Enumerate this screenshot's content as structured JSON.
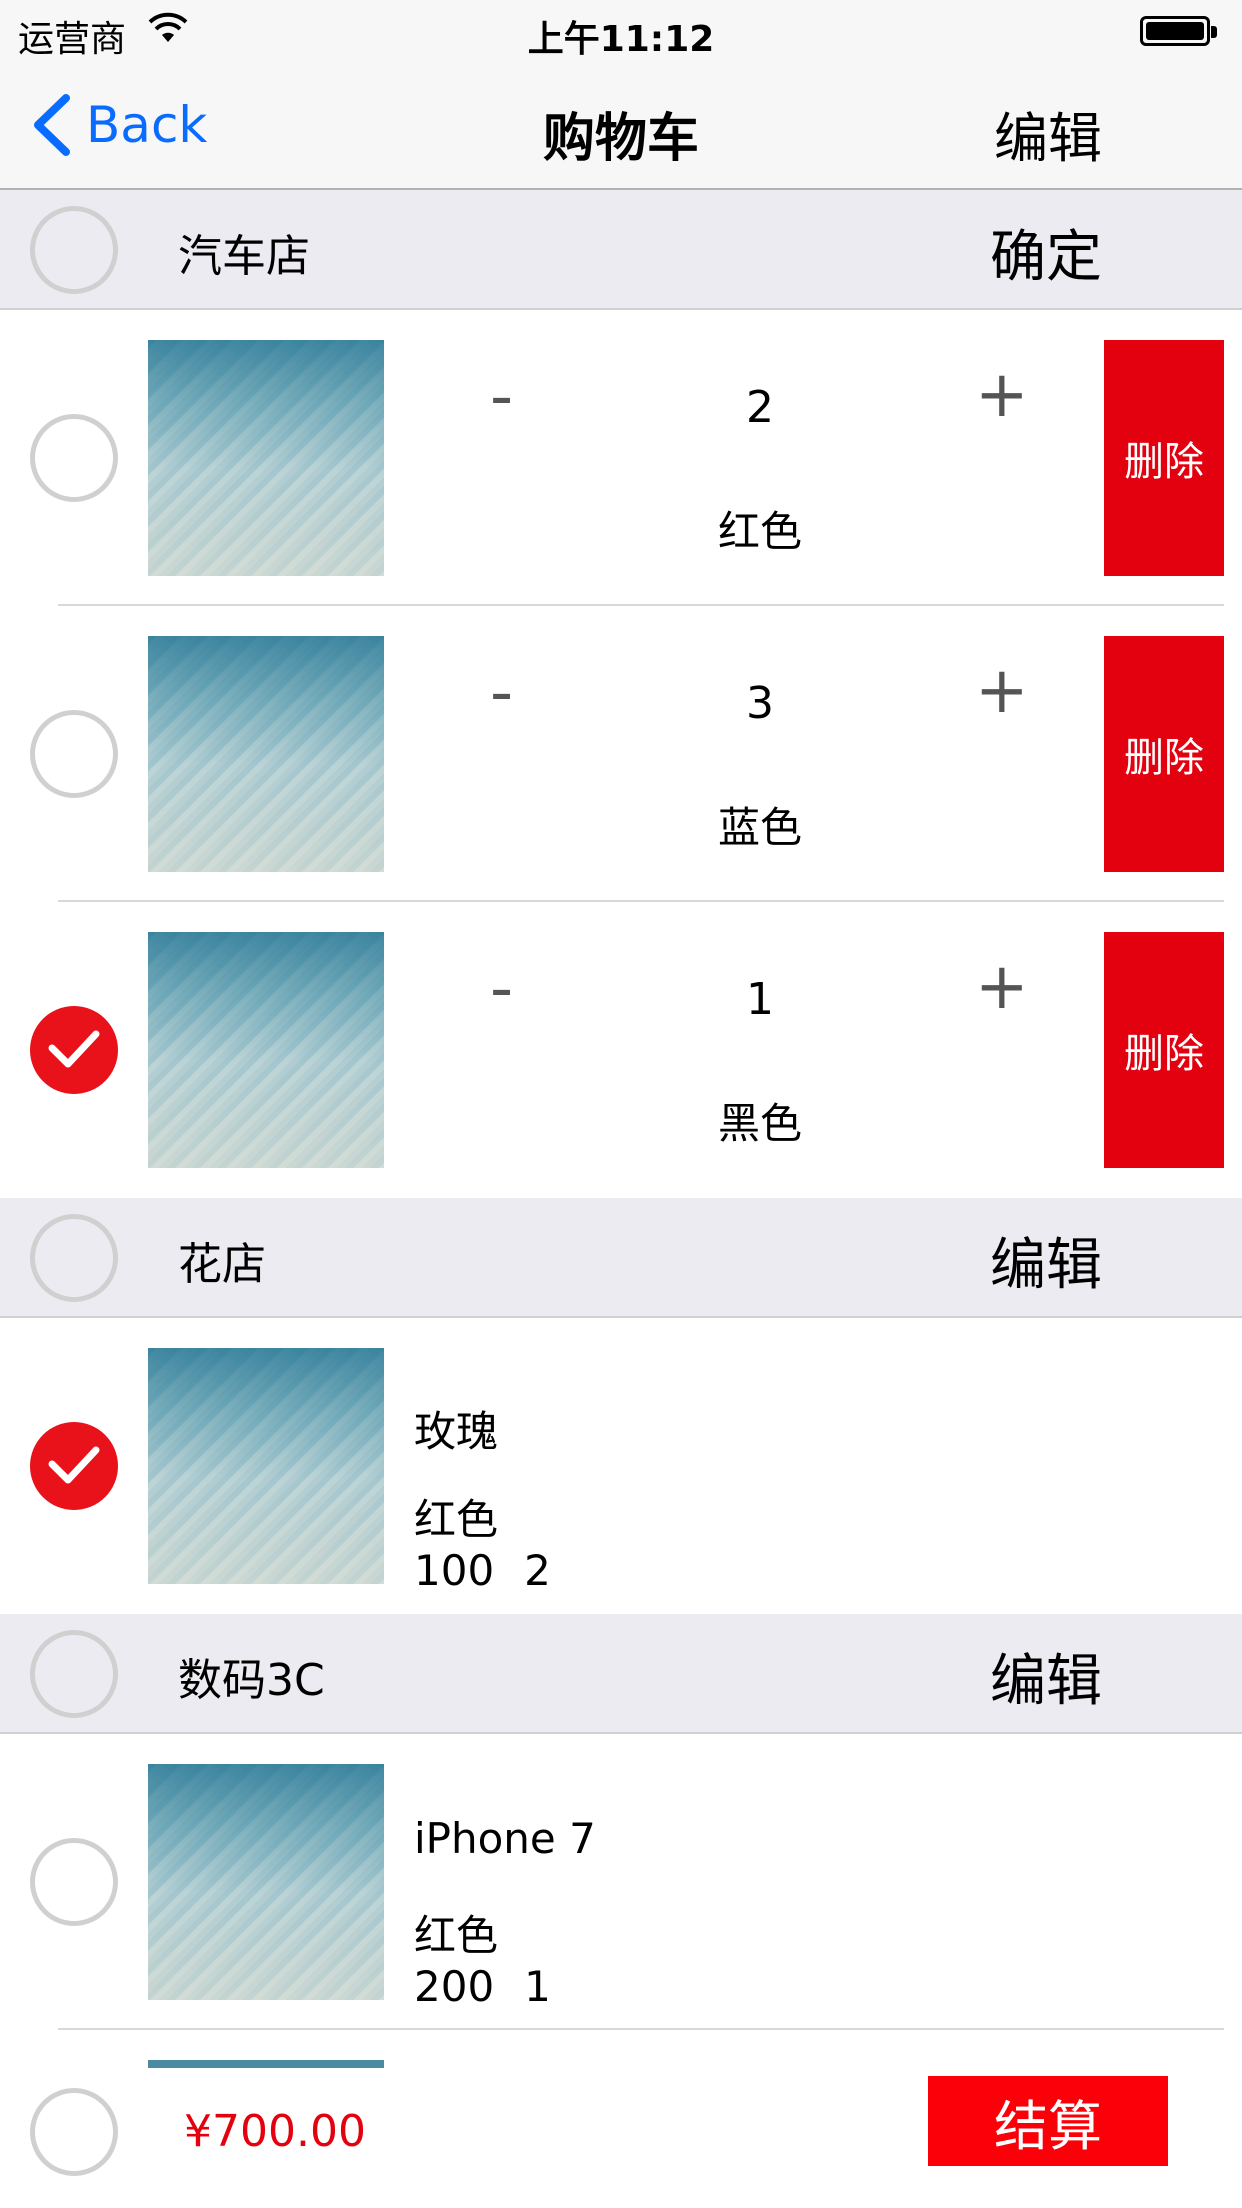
{
  "status_bar": {
    "carrier": "运营商",
    "time": "上午11:12"
  },
  "nav": {
    "back_label": "Back",
    "title": "购物车",
    "edit_label": "编辑"
  },
  "shops": [
    {
      "name": "汽车店",
      "action": "确定",
      "items": [
        {
          "qty": "2",
          "color": "红色",
          "delete_label": "删除",
          "checked": false
        },
        {
          "qty": "3",
          "color": "蓝色",
          "delete_label": "删除",
          "checked": false
        },
        {
          "qty": "1",
          "color": "黑色",
          "delete_label": "删除",
          "checked": true
        }
      ],
      "minus_label": "-",
      "plus_label": "+"
    },
    {
      "name": "花店",
      "action": "编辑",
      "items": [
        {
          "name": "玫瑰",
          "color": "红色",
          "price": "100",
          "qty": "2",
          "checked": true
        }
      ]
    },
    {
      "name": "数码3C",
      "action": "编辑",
      "items": [
        {
          "name": "iPhone 7",
          "color": "红色",
          "price": "200",
          "qty": "1",
          "checked": false
        }
      ]
    }
  ],
  "footer": {
    "total": "¥700.00",
    "checkout_label": "结算",
    "select_all_checked": false
  },
  "colors": {
    "accent_red": "#e3000f",
    "link_blue": "#0a6cff",
    "section_bg": "#ebebf1"
  }
}
